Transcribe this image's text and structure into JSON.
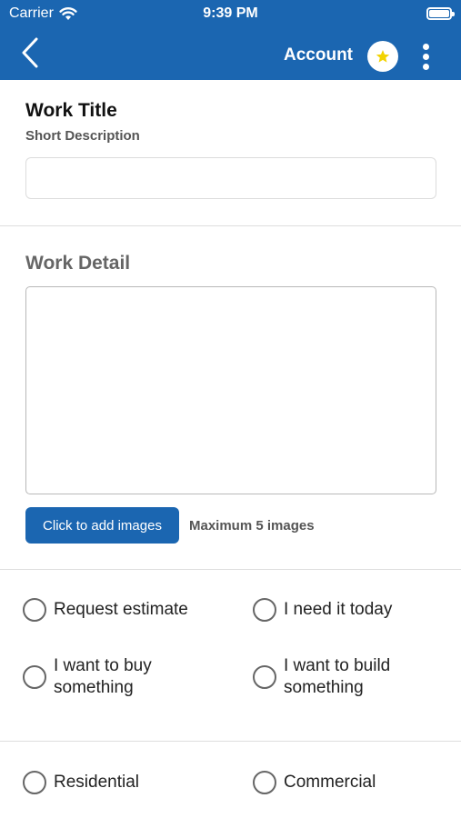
{
  "status_bar": {
    "carrier": "Carrier",
    "time": "9:39 PM"
  },
  "nav": {
    "title": "Account"
  },
  "form": {
    "title": "Work Title",
    "subtitle": "Short Description",
    "title_value": "",
    "detail_label": "Work Detail",
    "detail_value": "",
    "add_images_label": "Click to add images",
    "max_images_note": "Maximum 5 images"
  },
  "options": {
    "request_estimate": "Request estimate",
    "need_today": "I need it today",
    "want_buy": "I want to buy\nsomething",
    "want_build": "I want to build\nsomething",
    "residential": "Residential",
    "commercial": "Commercial"
  },
  "colors": {
    "brand": "#1b66b1",
    "star": "#f2d300"
  }
}
